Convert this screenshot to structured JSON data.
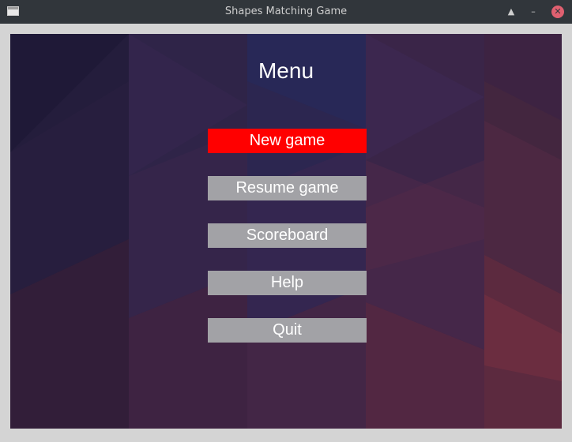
{
  "window": {
    "title": "Shapes Matching Game",
    "icons": [
      "app-window-icon",
      "keep-above-icon",
      "minimize-icon",
      "close-icon"
    ]
  },
  "menu": {
    "title": "Menu",
    "buttons": [
      {
        "label": "New game",
        "selected": true
      },
      {
        "label": "Resume game",
        "selected": false
      },
      {
        "label": "Scoreboard",
        "selected": false
      },
      {
        "label": "Help",
        "selected": false
      },
      {
        "label": "Quit",
        "selected": false
      }
    ]
  },
  "colors": {
    "titlebar": "#31363b",
    "selected_button": "#ff0000",
    "button": "#a2a2a6",
    "text": "#ffffff",
    "close_button": "#e06070"
  }
}
